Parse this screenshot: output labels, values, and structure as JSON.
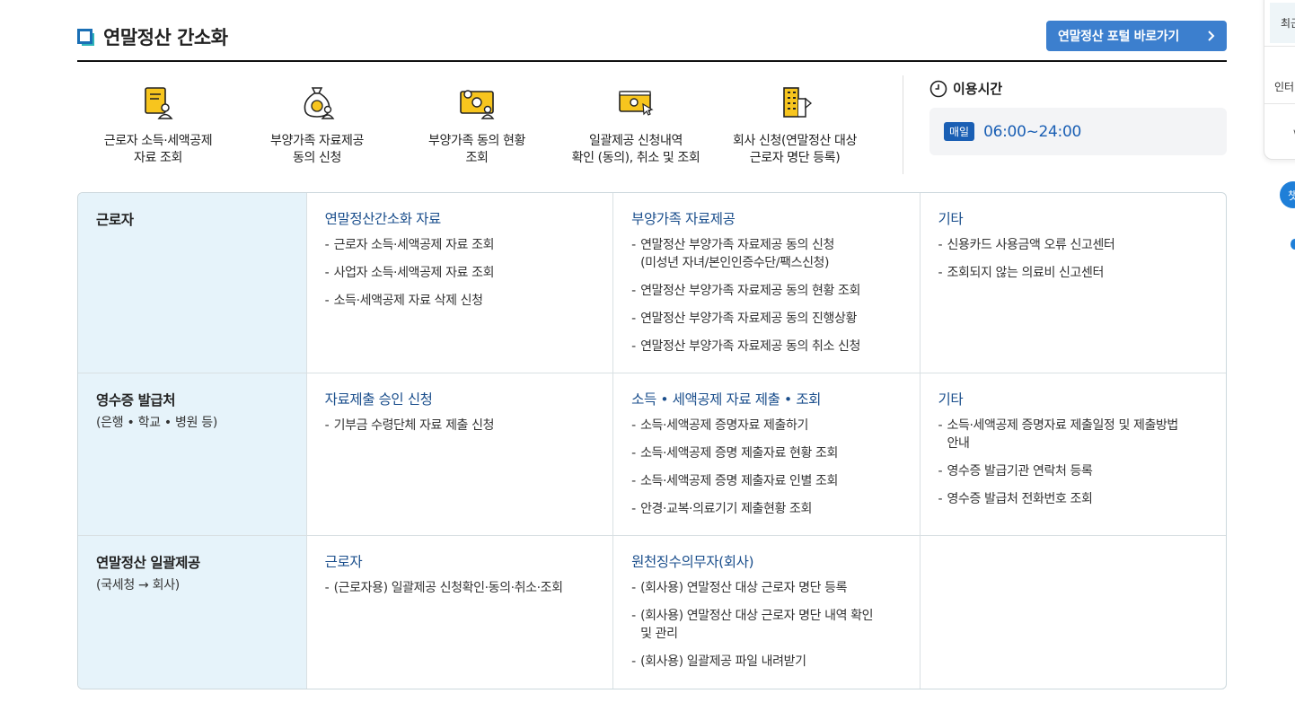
{
  "header": {
    "title": "연말정산 간소화",
    "portal_button": "연말정산 포털 바로가기"
  },
  "quick_menu": [
    {
      "label": "근로자 소득·세액공제\n자료 조회",
      "icon": "document-person-icon"
    },
    {
      "label": "부양가족 자료제공\n동의 신청",
      "icon": "money-bag-person-icon"
    },
    {
      "label": "부양가족 동의 현황\n조회",
      "icon": "family-card-icon"
    },
    {
      "label": "일괄제공 신청내역\n확인 (동의), 취소 및 조회",
      "icon": "monitor-click-icon"
    },
    {
      "label": "회사 신청(연말정산 대상\n근로자 명단 등록)",
      "icon": "building-flag-icon"
    }
  ],
  "hours": {
    "title": "이용시간",
    "badge": "매일",
    "value": "06:00~24:00"
  },
  "rows": [
    {
      "title": "근로자",
      "subtitle": "",
      "columns": [
        {
          "title": "연말정산간소화 자료",
          "items": [
            "근로자 소득·세액공제 자료 조회",
            "사업자 소득·세액공제 자료 조회",
            "소득·세액공제 자료 삭제 신청"
          ]
        },
        {
          "title": "부양가족 자료제공",
          "items": [
            "연말정산 부양가족 자료제공 동의 신청\n(미성년 자녀/본인인증수단/팩스신청)",
            "연말정산 부양가족 자료제공 동의 현황 조회",
            "연말정산 부양가족 자료제공 동의 진행상황",
            "연말정산 부양가족 자료제공 동의 취소 신청"
          ]
        },
        {
          "title": "기타",
          "items": [
            "신용카드 사용금액 오류 신고센터",
            "조회되지 않는 의료비 신고센터"
          ]
        }
      ]
    },
    {
      "title": "영수증 발급처",
      "subtitle": "(은행 • 학교 • 병원 등)",
      "columns": [
        {
          "title": "자료제출 승인 신청",
          "items": [
            "기부금 수령단체 자료 제출 신청"
          ]
        },
        {
          "title": "소득 • 세액공제 자료 제출 • 조회",
          "items": [
            "소득·세액공제 증명자료 제출하기",
            "소득·세액공제 증명 제출자료 현황 조회",
            "소득·세액공제 증명 제출자료 인별 조회",
            "안경·교복·의료기기 제출현황 조회"
          ]
        },
        {
          "title": "기타",
          "items": [
            "소득·세액공제 증명자료 제출일정 및 제출방법\n안내",
            "영수증 발급기관 연락처 등록",
            "영수증 발급처 전화번호 조회"
          ]
        }
      ]
    },
    {
      "title": "연말정산 일괄제공",
      "subtitle": "(국세청 → 회사)",
      "columns": [
        {
          "title": "근로자",
          "items": [
            "(근로자용) 일괄제공 신청확인·동의·취소·조회"
          ]
        },
        {
          "title": "원천징수의무자(회사)",
          "items": [
            "(회사용) 연말정산 대상 근로자 명단 등록",
            "(회사용) 연말정산 대상 근로자 명단 내역 확인\n및 관리",
            "(회사용) 일괄제공 파일 내려받기"
          ]
        },
        {
          "title": "",
          "items": []
        }
      ]
    }
  ],
  "side_panel": {
    "recent": "최근",
    "internet": "인터",
    "float_label": "챗"
  },
  "colors": {
    "accent": "#3c7fce",
    "title_link": "#1a4e8c",
    "row_head_bg": "#e6f3fa",
    "icon_yellow": "#f7c51e"
  }
}
